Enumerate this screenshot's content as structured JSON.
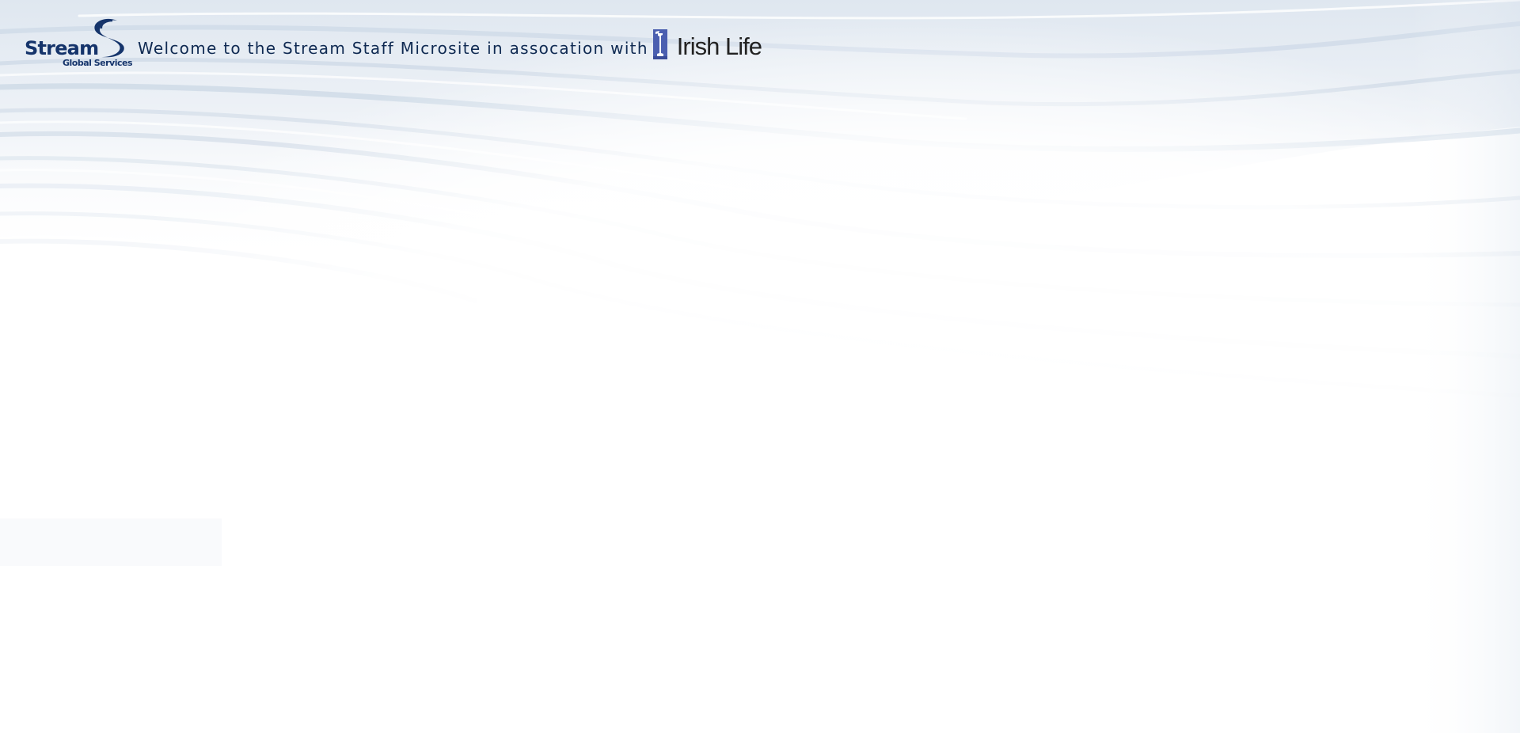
{
  "header": {
    "stream_logo": {
      "name": "Stream",
      "subtitle": "Global Services",
      "color": "#15346b"
    },
    "welcome_text": "Welcome to the Stream Staff Microsite in assocation with",
    "irish_life_logo": {
      "name": "Irish Life",
      "mark_color": "#4b5fb0",
      "text_color": "#222222"
    }
  },
  "background": {
    "style": "abstract-blue-swirl",
    "accent_color": "#b9c9dc"
  }
}
